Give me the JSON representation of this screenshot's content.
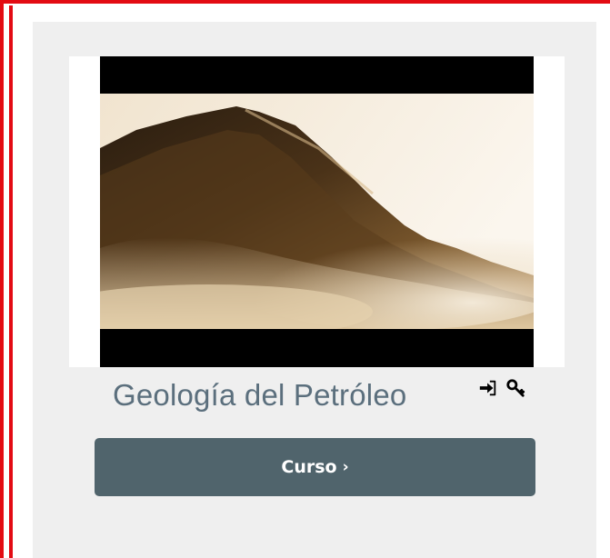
{
  "course": {
    "title": "Geología del Petróleo",
    "button_label": "Curso",
    "button_chevron": "›"
  },
  "icons": [
    "enrol-icon",
    "key-icon"
  ],
  "colors": {
    "highlight_border": "#e30b13",
    "card_bg": "#efefef",
    "title_color": "#5b6f7d",
    "button_bg": "#50646c"
  }
}
